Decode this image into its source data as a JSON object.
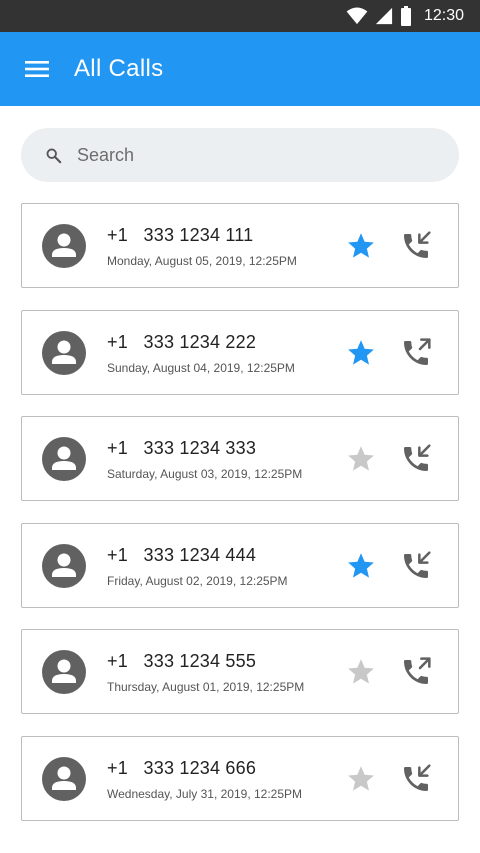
{
  "status_bar": {
    "time": "12:30"
  },
  "app_bar": {
    "title": "All Calls"
  },
  "search": {
    "placeholder": "Search"
  },
  "colors": {
    "primary": "#2196f3",
    "starred": "#2196f3",
    "unstarred": "#c8c8c8",
    "icon": "#616161"
  },
  "calls": [
    {
      "number": "+1   333 1234 111",
      "date": "Monday, August 05, 2019, 12:25PM",
      "starred": true,
      "direction": "incoming"
    },
    {
      "number": "+1   333 1234 222",
      "date": "Sunday, August 04, 2019, 12:25PM",
      "starred": true,
      "direction": "outgoing"
    },
    {
      "number": "+1   333 1234 333",
      "date": "Saturday, August 03, 2019, 12:25PM",
      "starred": false,
      "direction": "incoming"
    },
    {
      "number": "+1   333 1234 444",
      "date": "Friday, August 02, 2019, 12:25PM",
      "starred": true,
      "direction": "incoming"
    },
    {
      "number": "+1   333 1234 555",
      "date": "Thursday, August 01, 2019, 12:25PM",
      "starred": false,
      "direction": "outgoing"
    },
    {
      "number": "+1   333 1234 666",
      "date": "Wednesday, July 31, 2019, 12:25PM",
      "starred": false,
      "direction": "incoming"
    }
  ]
}
